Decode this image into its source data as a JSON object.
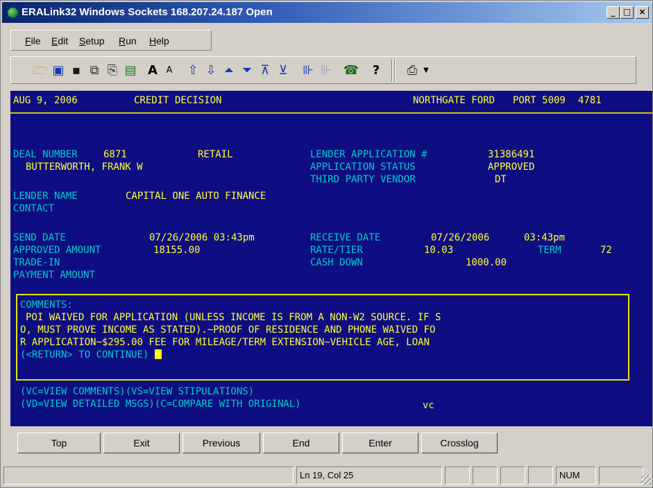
{
  "window": {
    "title": "ERALink32 Windows Sockets 168.207.24.187 Open",
    "controls": [
      "_",
      "□",
      "×"
    ]
  },
  "menu": [
    "File",
    "Edit",
    "Setup",
    "Run",
    "Help"
  ],
  "toolbar_icons": [
    "open-folder-icon",
    "monitor-icon",
    "save-icon",
    "copy-icon",
    "paste-icon",
    "print-screen-icon",
    "font-increase-icon",
    "font-decrease-icon",
    "arrow-up-icon",
    "arrow-down-icon",
    "double-arrow-up-icon",
    "double-arrow-down-icon",
    "first-icon",
    "last-icon",
    "connect-icon",
    "disconnect-icon",
    "phone-icon",
    "help-icon",
    "printer-icon"
  ],
  "terminal": {
    "header": {
      "date": "AUG 9, 2006",
      "screen_title": "CREDIT DECISION",
      "dealer": "NORTHGATE FORD",
      "port": "PORT 5009",
      "code": "4781"
    },
    "deal": {
      "deal_number_label": "DEAL NUMBER",
      "deal_number": "6871",
      "deal_type": "RETAIL",
      "customer": "BUTTERWORTH, FRANK W",
      "lender_app_label": "LENDER APPLICATION #",
      "lender_app": "31386491",
      "app_status_label": "APPLICATION STATUS",
      "app_status": "APPROVED",
      "vendor_label": "THIRD PARTY VENDOR",
      "vendor": "DT",
      "lender_name_label": "LENDER NAME",
      "lender_name": "CAPITAL ONE AUTO FINANCE",
      "contact_label": "CONTACT"
    },
    "terms": {
      "send_date_label": "SEND DATE",
      "send_date": "07/26/2006 03:43pm",
      "receive_date_label": "RECEIVE DATE",
      "receive_date": "07/26/2006",
      "receive_time": "03:43pm",
      "approved_amount_label": "APPROVED AMOUNT",
      "approved_amount": "18155.00",
      "rate_label": "RATE/TIER",
      "rate": "10.03",
      "term_label": "TERM",
      "term": "72",
      "tradein_label": "TRADE-IN",
      "cash_down_label": "CASH DOWN",
      "cash_down": "1000.00",
      "payment_label": "PAYMENT AMOUNT"
    },
    "comments": {
      "label": "COMMENTS:",
      "lines": [
        "POI WAIVED FOR APPLICATION (UNLESS INCOME IS FROM A NON-W2 SOURCE. IF S",
        "O, MUST PROVE INCOME AS STATED).~PROOF OF RESIDENCE AND PHONE WAIVED FO",
        "R APPLICATION~$295.00 FEE FOR MILEAGE/TERM EXTENSION~VEHICLE AGE, LOAN"
      ],
      "continue": "(<RETURN> TO CONTINUE)"
    },
    "options": [
      "(VC=VIEW COMMENTS)(VS=VIEW STIPULATIONS)",
      "(VD=VIEW DETAILED MSGS)(C=COMPARE WITH ORIGINAL)"
    ],
    "input_value": "vc"
  },
  "buttons": [
    "Top",
    "Exit",
    "Previous",
    "End",
    "Enter",
    "Crosslog"
  ],
  "status": {
    "position": "Ln 19, Col 25",
    "num": "NUM"
  }
}
